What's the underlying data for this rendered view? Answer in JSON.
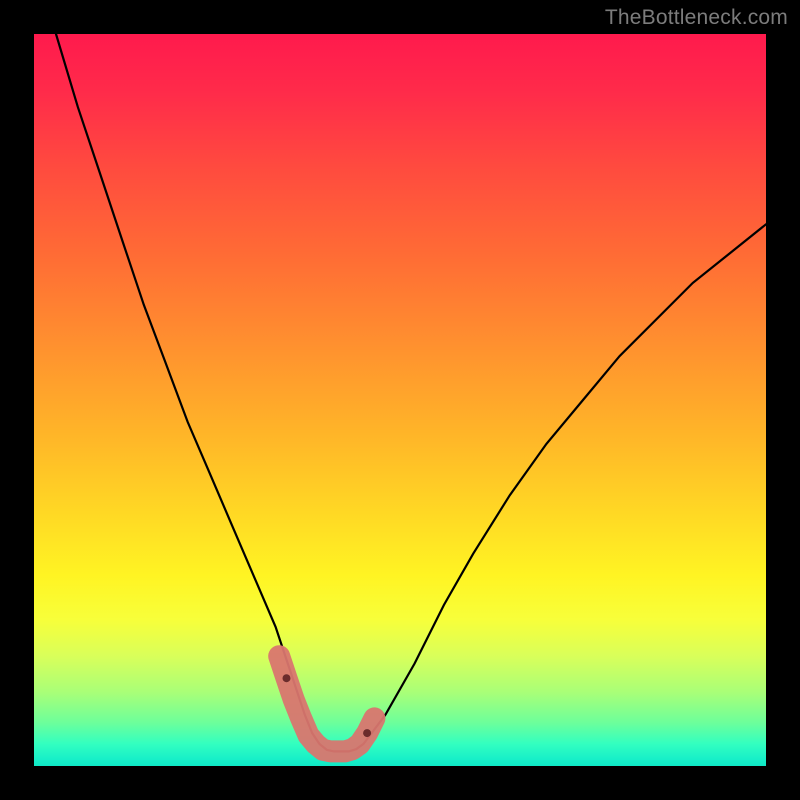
{
  "watermark": {
    "text": "TheBottleneck.com"
  },
  "chart_data": {
    "type": "line",
    "title": "",
    "xlabel": "",
    "ylabel": "",
    "xlim": [
      0,
      100
    ],
    "ylim": [
      0,
      100
    ],
    "grid": false,
    "legend": false,
    "series": [
      {
        "name": "bottleneck-curve",
        "color": "#000000",
        "x": [
          0,
          3,
          6,
          9,
          12,
          15,
          18,
          21,
          24,
          27,
          30,
          33,
          34,
          35,
          36,
          37,
          38,
          39,
          40,
          41,
          42,
          43,
          44,
          45,
          48,
          52,
          56,
          60,
          65,
          70,
          75,
          80,
          85,
          90,
          95,
          100
        ],
        "y": [
          110,
          100,
          90,
          81,
          72,
          63,
          55,
          47,
          40,
          33,
          26,
          19,
          16,
          13,
          10,
          7,
          4.5,
          3,
          2.2,
          2,
          2,
          2,
          2.3,
          3,
          7,
          14,
          22,
          29,
          37,
          44,
          50,
          56,
          61,
          66,
          70,
          74
        ]
      },
      {
        "name": "highlight-markers",
        "color": "#d9766f",
        "x": [
          33.5,
          34.5,
          35.5,
          36.5,
          37.5,
          38.5,
          39.5,
          40.5,
          41.5,
          42.5,
          43.5,
          44.5,
          45.5,
          46.5
        ],
        "y": [
          15,
          12,
          9,
          6.5,
          4.2,
          3,
          2.2,
          2,
          2,
          2,
          2.3,
          3,
          4.5,
          6.5
        ]
      }
    ]
  }
}
